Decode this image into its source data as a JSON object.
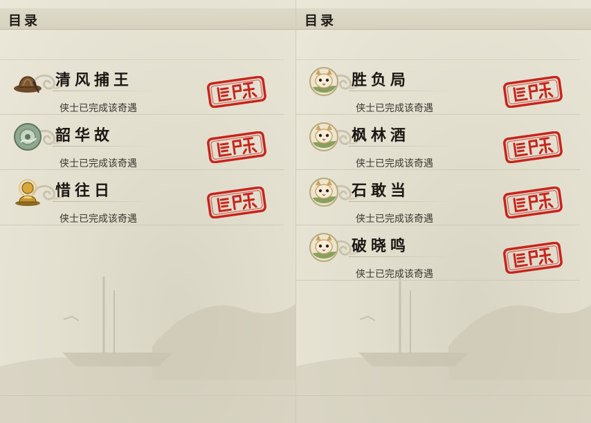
{
  "left_panel": {
    "header": {
      "title": "目录"
    },
    "entries": [
      {
        "title": "清风捕王",
        "status": "侠士已完成该奇遇",
        "icon": "straw-hat-icon"
      },
      {
        "title": "韶华故",
        "status": "侠士已完成该奇遇",
        "icon": "jade-disc-icon"
      },
      {
        "title": "惜往日",
        "status": "侠士已完成该奇遇",
        "icon": "golden-buddha-icon"
      }
    ]
  },
  "right_panel": {
    "header": {
      "title": "目录"
    },
    "entries": [
      {
        "title": "胜负局",
        "status": "侠士已完成该奇遇",
        "icon": "cat-icon"
      },
      {
        "title": "枫林酒",
        "status": "侠士已完成该奇遇",
        "icon": "cat-icon"
      },
      {
        "title": "石敢当",
        "status": "侠士已完成该奇遇",
        "icon": "cat-icon"
      },
      {
        "title": "破晓鸣",
        "status": "侠士已完成该奇遇",
        "icon": "cat-icon"
      }
    ]
  },
  "colors": {
    "stamp_red": "#c8231c",
    "paper": "#e7e3d4",
    "ink": "#1a1712"
  }
}
